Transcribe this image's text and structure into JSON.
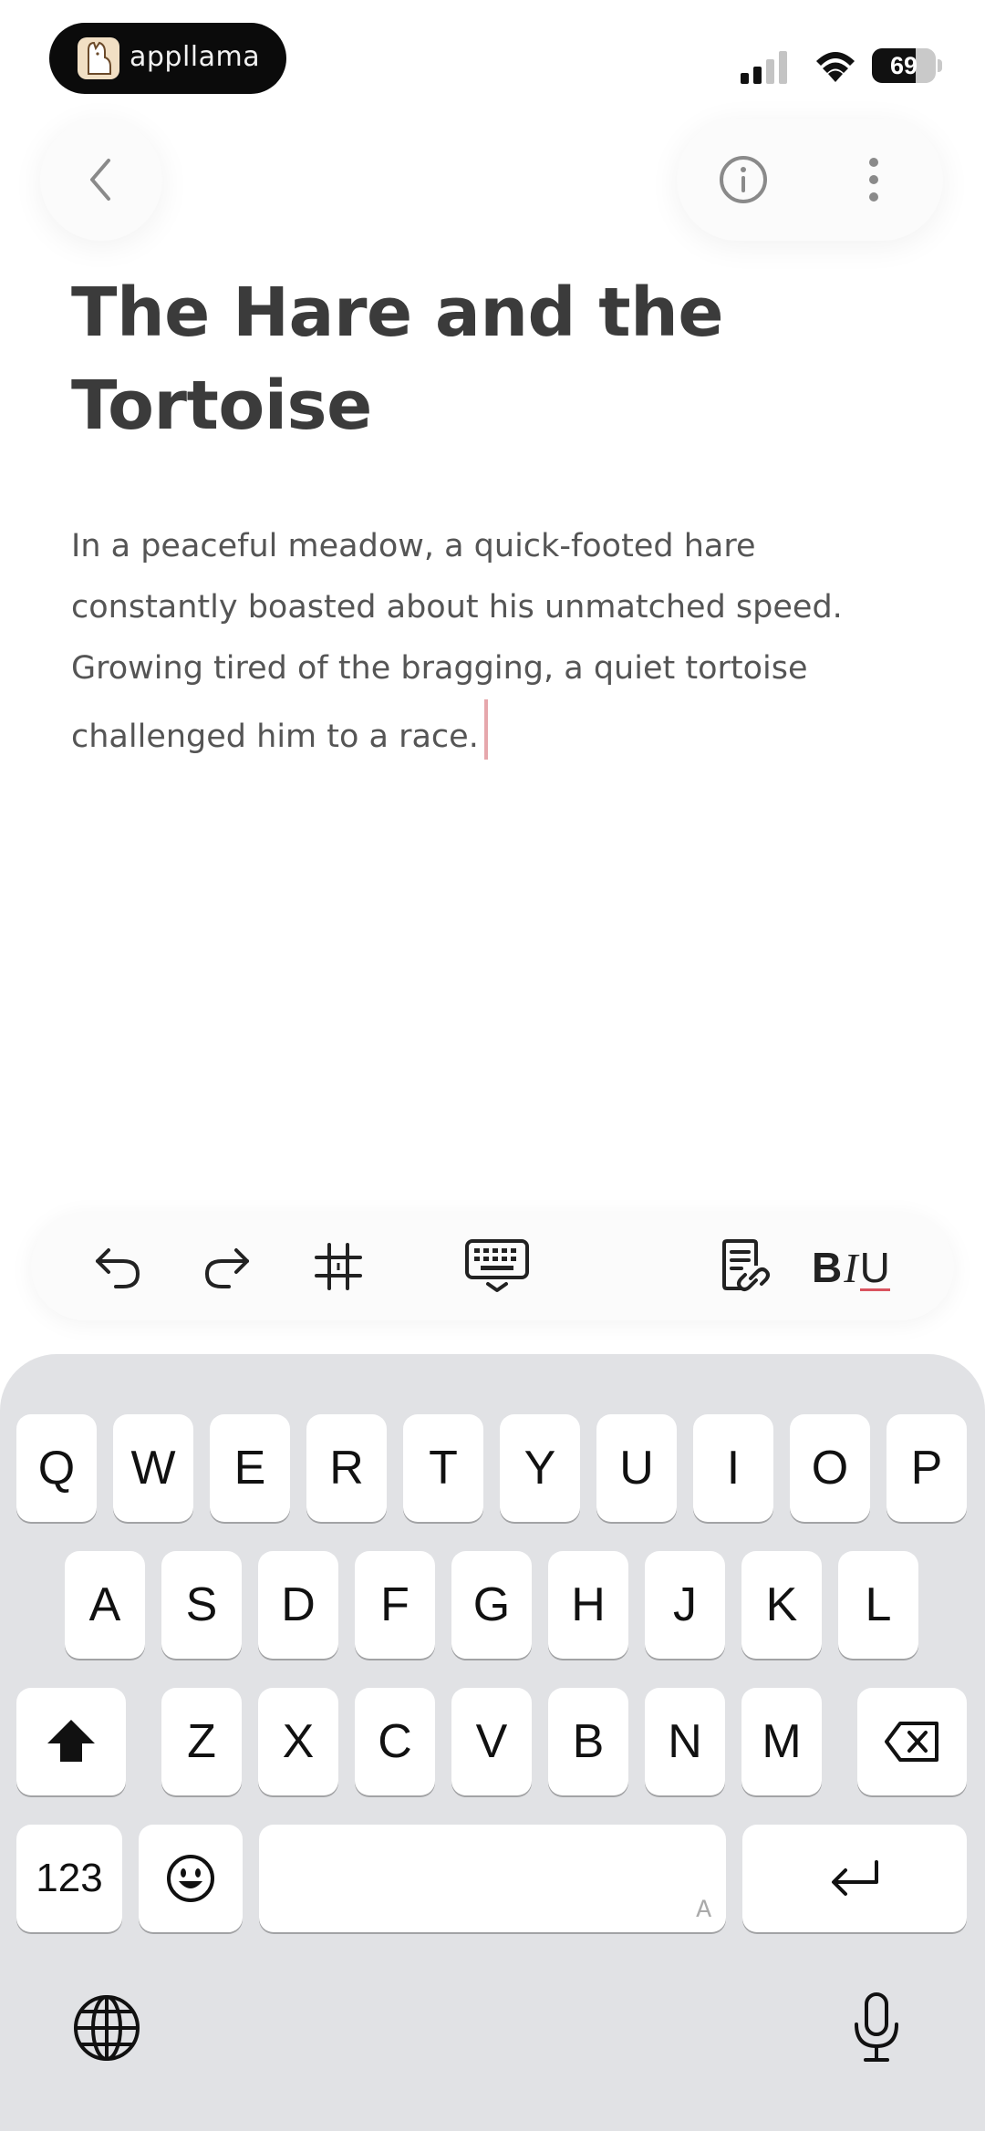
{
  "status_bar": {
    "app_name": "appllama",
    "battery_level": "69",
    "battery_fraction": 0.69,
    "signal_bars": 2
  },
  "nav": {
    "back_icon": "chevron-left-icon",
    "info_icon": "info-icon",
    "more_icon": "more-vertical-icon"
  },
  "document": {
    "title": "The Hare and the Tortoise",
    "body": "In a peaceful meadow, a quick-footed hare constantly boasted about his unmatched speed. Growing tired of the bragging, a quiet tortoise challenged him to a race."
  },
  "toolbar": {
    "buttons": [
      "undo-icon",
      "redo-icon",
      "hashtag-icon",
      "keyboard-dismiss-icon",
      "linked-note-icon"
    ],
    "biu_b": "B",
    "biu_i": "I",
    "biu_u": "U"
  },
  "keyboard": {
    "row1": [
      "Q",
      "W",
      "E",
      "R",
      "T",
      "Y",
      "U",
      "I",
      "O",
      "P"
    ],
    "row2": [
      "A",
      "S",
      "D",
      "F",
      "G",
      "H",
      "J",
      "K",
      "L"
    ],
    "row3": [
      "Z",
      "X",
      "C",
      "V",
      "B",
      "N",
      "M"
    ],
    "numbers_label": "123",
    "space_hint": "A"
  },
  "colors": {
    "caret": "#e6a7ac",
    "underline_accent": "#d9535f",
    "keyboard_bg": "#e1e2e5"
  }
}
